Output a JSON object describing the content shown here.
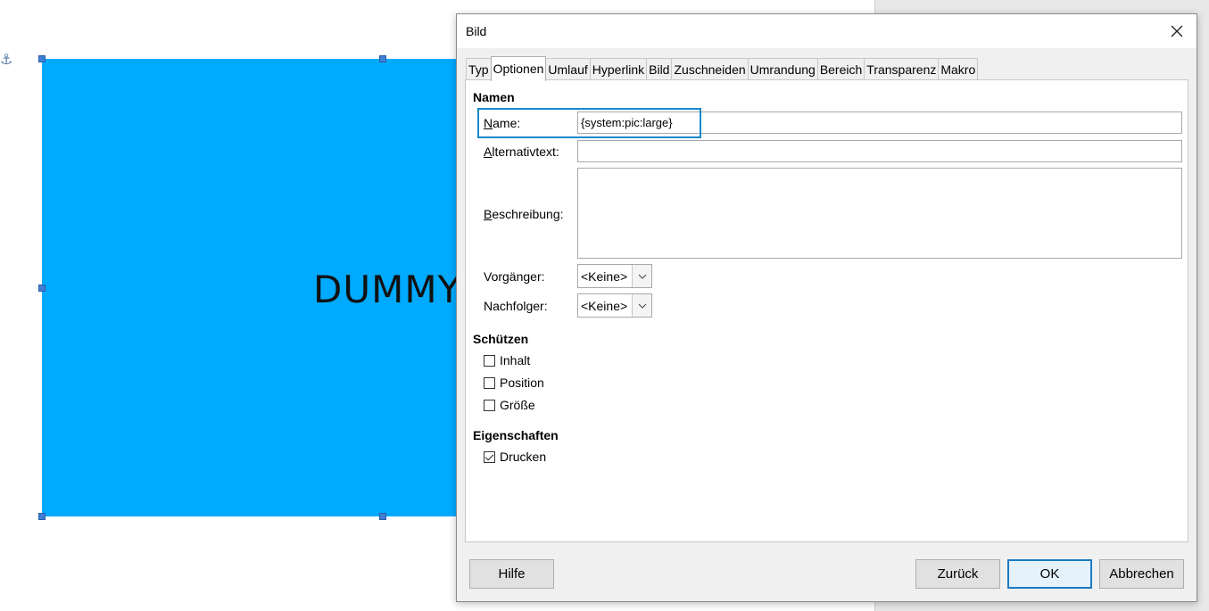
{
  "document": {
    "image_text": "DUMMY"
  },
  "dialog": {
    "title": "Bild",
    "tabs": [
      {
        "label": "Typ"
      },
      {
        "label": "Optionen"
      },
      {
        "label": "Umlauf"
      },
      {
        "label": "Hyperlink"
      },
      {
        "label": "Bild"
      },
      {
        "label": "Zuschneiden"
      },
      {
        "label": "Umrandung"
      },
      {
        "label": "Bereich"
      },
      {
        "label": "Transparenz"
      },
      {
        "label": "Makro"
      }
    ],
    "sections": {
      "namen": "Namen",
      "schuetzen": "Schützen",
      "eigenschaften": "Eigenschaften"
    },
    "fields": {
      "name_label_u": "N",
      "name_label_rest": "ame:",
      "name_value": "{system:pic:large}",
      "alt_label_u": "A",
      "alt_label_rest": "lternativtext:",
      "alt_value": "",
      "desc_label_u": "B",
      "desc_label_rest": "eschreibung:",
      "vorg_label_u": "V",
      "vorg_label_rest": "organger:",
      "vorg_label_full": "Vorgänger:",
      "vorg_value": "<Keine>",
      "nachf_label_full": "Nachfolger:",
      "nachf_value": "<Keine>"
    },
    "protect": {
      "inhalt": "Inhalt",
      "position": "Position",
      "groesse": "Größe"
    },
    "properties": {
      "drucken": "Drucken"
    },
    "buttons": {
      "help": "Hilfe",
      "back": "Zurück",
      "ok": "OK",
      "cancel": "Abbrechen"
    },
    "icons": {
      "close": "close-icon",
      "dropdown": "chevron-down-icon",
      "anchor": "anchor-icon"
    },
    "colors": {
      "image_fill": "#00aaff",
      "focus": "#1a88c9"
    }
  }
}
